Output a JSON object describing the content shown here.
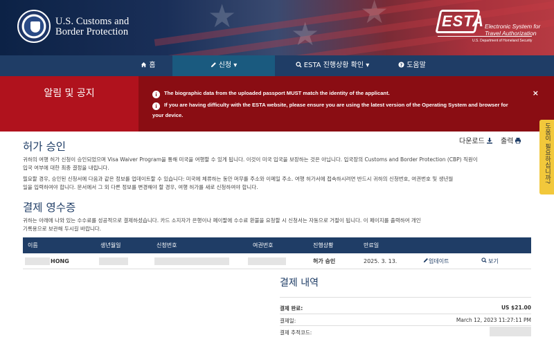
{
  "header": {
    "agency_line1": "U.S. Customs and",
    "agency_line2": "Border Protection",
    "esta_logo": "ESTA",
    "esta_sub_line1": "Electronic System for",
    "esta_sub_line2": "Travel Authorization",
    "esta_dept": "U.S. Department of Homeland Security"
  },
  "nav": {
    "home": "홈",
    "apply": "신청",
    "status": "ESTA 진행상황 확인",
    "help": "도움말"
  },
  "alert": {
    "title": "알림 및 공지",
    "line1": "The biographic data from the uploaded passport MUST match the identity of the applicant.",
    "line2a": "If you are having difficulty with the ESTA website, please ensure you are using the latest version of the Operating System and browser for",
    "line2b": "your device.",
    "close": "×"
  },
  "side_tab": "도움이 필요하십니까?",
  "tools": {
    "download": "다운로드",
    "print": "출력"
  },
  "approval": {
    "title": "허가 승인",
    "p1a": "귀하의 여행 허가 신청이 승인되었으며 Visa Waiver Program을 통해 미국을 여행할 수 있게 됩니다. 이것이 미국 입국을 보장하는 것은 아닙니다. 입국장의 Customs and Border Protection (CBP) 직원이",
    "p1b": "입국 여부에 대한 최종 결정을 내립니다.",
    "p2a": "필요할 경우, 승인된 신청서에 다음과 같은 정보를 업데이트할 수 있습니다: 미국에 체류하는 동안 머무를 주소와 이메일 주소. 여행 허가서에 접속하시려면 반드시 귀하의 신청번호, 여권번호 및 생년월",
    "p2b": "일을 입력하여야 합니다. 문서에서 그 외 다른 정보를 변경해야 할 경우, 여행 허가를 새로 신청하여야 합니다."
  },
  "receipt": {
    "title": "결제 영수증",
    "p1a": "귀하는 아래에 나와 있는 수수료를 성공적으로 결제하셨습니다. 카드 소지자가 은행이나 페이팔에 수수료 환불을 요청할 시 신청서는 자동으로 거절이 됩니다. 이 페이지를 출력하여 개인",
    "p1b": "기록용으로 보관해 두시길 바랍니다."
  },
  "table": {
    "headers": [
      "이름",
      "생년월일",
      "신청번호",
      "여권번호",
      "진행상황",
      "만료일"
    ],
    "row": {
      "name": "HONG",
      "status": "허가 승인",
      "expiry": "2025. 3. 13.",
      "update": "업데이트",
      "view": "보기"
    }
  },
  "payment": {
    "title": "결제 내역",
    "complete_label": "결제 완료:",
    "complete_value": "US $21.00",
    "date_label": "결제일:",
    "date_value": "March 12, 2023 11:27:11 PM",
    "tracking_label": "결제 추적코드:"
  }
}
